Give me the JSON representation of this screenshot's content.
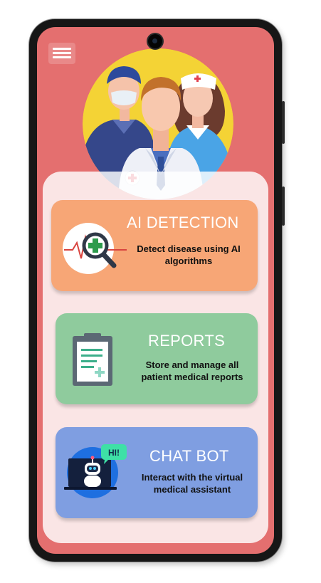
{
  "colors": {
    "screen_bg": "#e46f6f",
    "panel_bg": "#fbe4e4",
    "ai_detection": "#f7a676",
    "reports": "#8fcb9d",
    "chat_bot": "#7f9ee1"
  },
  "header": {
    "menu_icon": "hamburger-menu-icon"
  },
  "hero": {
    "image": "medical-team-illustration"
  },
  "cards": [
    {
      "title": "AI DETECTION",
      "desc1": "Detect disease using AI",
      "desc2": "algorithms",
      "icon": "magnifier-heartbeat-icon"
    },
    {
      "title": "REPORTS",
      "desc1": "Store and manage all",
      "desc2": "patient medical reports",
      "icon": "clipboard-report-icon"
    },
    {
      "title": "CHAT BOT",
      "desc1": "Interact with the virtual",
      "desc2": "medical assistant",
      "icon": "chatbot-robot-icon",
      "bubble": "HI!"
    }
  ]
}
